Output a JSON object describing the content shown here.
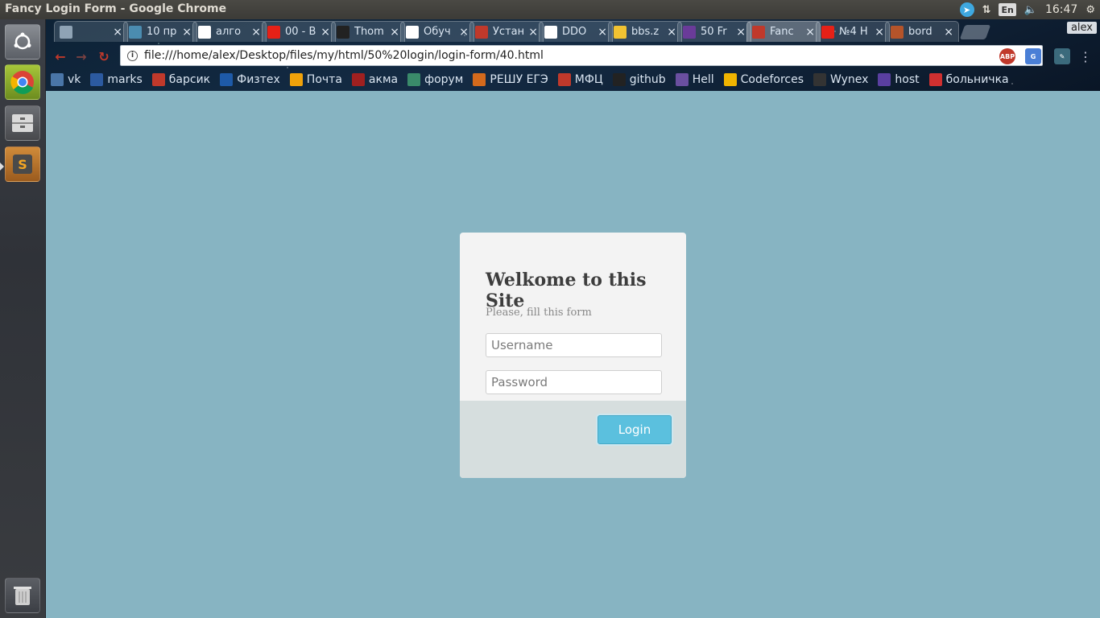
{
  "panel": {
    "window_title": "Fancy Login Form - Google Chrome",
    "keyboard_layout": "En",
    "clock": "16:47",
    "indicators": [
      "telegram-icon",
      "network-icon",
      "keyboard-icon",
      "volume-icon",
      "settings-gear-icon"
    ]
  },
  "launcher": {
    "items": [
      "ubuntu-home-icon",
      "chrome-icon",
      "files-icon",
      "sublime-text-icon",
      "trash-icon"
    ]
  },
  "browser": {
    "profile": "alex",
    "tabs": [
      {
        "title": "",
        "icon": "speaker-icon",
        "color": "#8fa3b5"
      },
      {
        "title": "10 пр",
        "icon": "h-icon",
        "color": "#4b8cb0"
      },
      {
        "title": "алго",
        "icon": "google-icon",
        "color": "#ffffff"
      },
      {
        "title": "00 - B",
        "icon": "youtube-icon",
        "color": "#e62117"
      },
      {
        "title": "Thom",
        "icon": "circle-logo-icon",
        "color": "#222222"
      },
      {
        "title": "Обуч",
        "icon": "t-icon",
        "color": "#ffffff"
      },
      {
        "title": "Устан",
        "icon": "ruby-icon",
        "color": "#c0392b"
      },
      {
        "title": "DDO",
        "icon": "t-icon",
        "color": "#ffffff"
      },
      {
        "title": "bbs.z",
        "icon": "folder-icon",
        "color": "#f1c232"
      },
      {
        "title": "50 Fr",
        "icon": "colorlib-icon",
        "color": "#6a3b99"
      },
      {
        "title": "Fanc",
        "icon": "page-icon",
        "color": "#c0392b",
        "active": true
      },
      {
        "title": "№4 H",
        "icon": "youtube-icon",
        "color": "#e62117"
      },
      {
        "title": "bord",
        "icon": "tiles-icon",
        "color": "#b5542a"
      }
    ],
    "url": "file:///home/alex/Desktop/files/my/html/50%20login/login-form/40.html",
    "bookmarks": [
      {
        "label": "vk",
        "color": "#4a76a8"
      },
      {
        "label": "marks",
        "color": "#2c5aa0"
      },
      {
        "label": "барсик",
        "color": "#c0392b"
      },
      {
        "label": "Физтех",
        "color": "#1e5aa8"
      },
      {
        "label": "Почта",
        "color": "#f1a20a"
      },
      {
        "label": "акма",
        "color": "#a02020"
      },
      {
        "label": "форум",
        "color": "#3a8a6a"
      },
      {
        "label": "РЕШУ ЕГЭ",
        "color": "#d46a1c"
      },
      {
        "label": "МФЦ",
        "color": "#c0392b"
      },
      {
        "label": "github",
        "color": "#222222"
      },
      {
        "label": "Hell",
        "color": "#6a4fa0"
      },
      {
        "label": "Codeforces",
        "color": "#f0b400"
      },
      {
        "label": "Wynex",
        "color": "#333333"
      },
      {
        "label": "host",
        "color": "#5a3fa0"
      },
      {
        "label": "больничка",
        "color": "#d03030"
      }
    ]
  },
  "page": {
    "background": "#87b4c2",
    "title": "Welkome to this Site",
    "subtitle": "Please, fill this form",
    "username_placeholder": "Username",
    "password_placeholder": "Password",
    "login_label": "Login",
    "accent": "#5bc0de"
  }
}
